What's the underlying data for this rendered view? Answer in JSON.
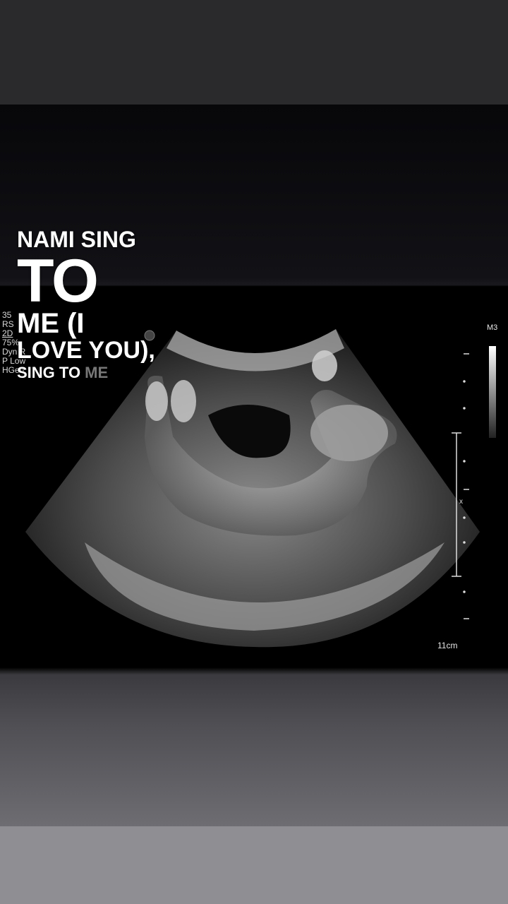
{
  "overlay_caption": {
    "line1": "NAMI SING",
    "line2": "TO",
    "line3": "ME (I",
    "line4": "LOVE YOU),",
    "line5_bright": "SING TO",
    "line5_dim": " ME"
  },
  "ultrasound": {
    "left_readout": [
      "35",
      "RS",
      "2D",
      "75%",
      "Dyn R",
      "P Low",
      "HGen"
    ],
    "mode": "M3",
    "depth": "11cm"
  }
}
